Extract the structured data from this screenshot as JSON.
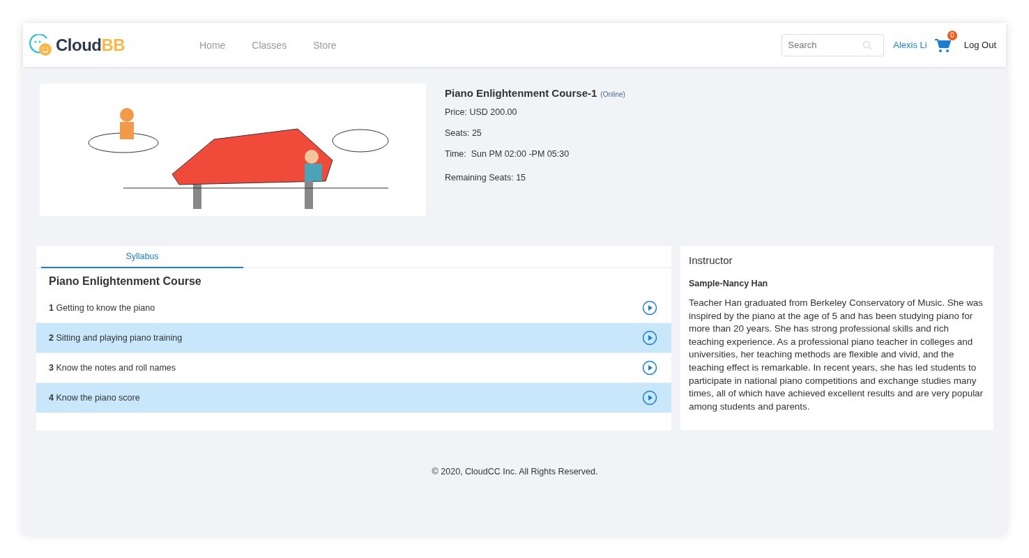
{
  "header": {
    "logo": {
      "word_dark": "Cloud",
      "word_accent": "BB"
    },
    "nav": [
      {
        "label": "Home"
      },
      {
        "label": "Classes"
      },
      {
        "label": "Store"
      }
    ],
    "search": {
      "placeholder": "Search"
    },
    "user": "Alexis Li",
    "cart_count": "0",
    "logout": "Log Out"
  },
  "course": {
    "title": "Piano Enlightenment Course-1",
    "mode": "(Online)",
    "details": [
      "Price: USD 200.00",
      "Seats: 25",
      "Time:  Sun PM 02:00 -PM 05:30",
      "Remaining Seats: 15"
    ]
  },
  "tabs": [
    {
      "label": "Syllabus",
      "selected": true
    }
  ],
  "syllabus": {
    "title": "Piano Enlightenment Course",
    "lessons": [
      {
        "number": "1",
        "title": "Getting to know the piano",
        "highlighted": false
      },
      {
        "number": "2",
        "title": "Sitting and playing piano training",
        "highlighted": true
      },
      {
        "number": "3",
        "title": "Know the notes and roll names",
        "highlighted": false
      },
      {
        "number": "4",
        "title": "Know the piano score",
        "highlighted": true
      }
    ]
  },
  "instructor": {
    "heading": "Instructor",
    "name": "Sample-Nancy Han",
    "bio": "Teacher Han graduated from Berkeley Conservatory of Music. She was inspired by the piano at the age of 5 and has been studying piano for more than 20 years. She has strong professional skills and rich teaching experience. As a professional piano teacher in colleges and universities, her teaching methods are flexible and vivid, and the teaching effect is remarkable. In recent years, she has led students to participate in national piano competitions and exchange studies many times, all of which have achieved excellent results and are very popular among students and parents."
  },
  "footer": "© 2020, CloudCC Inc. All Rights Reserved."
}
